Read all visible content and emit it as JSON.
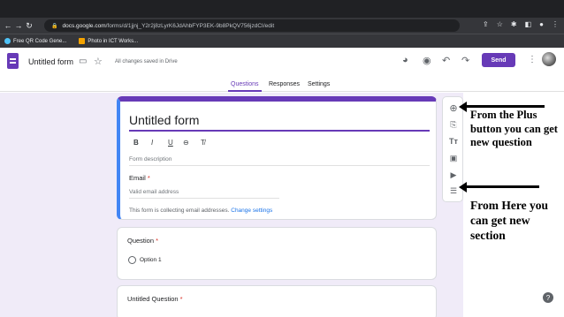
{
  "browser": {
    "url_host": "docs.google.com",
    "url_path": "/forms/d/1jjnj_Y2r2j8zLyrK6JdAhbFYP3EK-9b8PkQV756jzdCI/edit",
    "bookmarks": [
      {
        "label": "Free QR Code Gene..."
      },
      {
        "label": "Photo in ICT Works..."
      }
    ]
  },
  "header": {
    "form_title": "Untitled form",
    "saved_status": "All changes saved in Drive",
    "send_label": "Send"
  },
  "tabs": [
    {
      "label": "Questions",
      "active": true
    },
    {
      "label": "Responses",
      "active": false
    },
    {
      "label": "Settings",
      "active": false
    }
  ],
  "title_card": {
    "title": "Untitled form",
    "format_buttons": [
      "B",
      "I",
      "U",
      "⊖",
      "T̸"
    ],
    "description_placeholder": "Form description",
    "email_label": "Email",
    "required_mark": "*",
    "email_placeholder": "Valid email address",
    "collecting_text": "This form is collecting email addresses.",
    "change_settings": "Change settings"
  },
  "question_card": {
    "label": "Question",
    "required_mark": "*",
    "option": "Option 1"
  },
  "question_card_2": {
    "label": "Untitled Question",
    "required_mark": "*"
  },
  "toolbar": {
    "tools": [
      {
        "icon": "add-question-icon"
      },
      {
        "icon": "import-questions-icon"
      },
      {
        "icon": "add-title-icon"
      },
      {
        "icon": "add-image-icon"
      },
      {
        "icon": "add-video-icon"
      },
      {
        "icon": "add-section-icon"
      }
    ]
  },
  "annotations": {
    "plus_note": "From the Plus button you can get new question",
    "section_note": "From Here you can get new section"
  },
  "colors": {
    "accent": "#673ab7",
    "background": "#f0ebf8",
    "link": "#1a73e8"
  }
}
